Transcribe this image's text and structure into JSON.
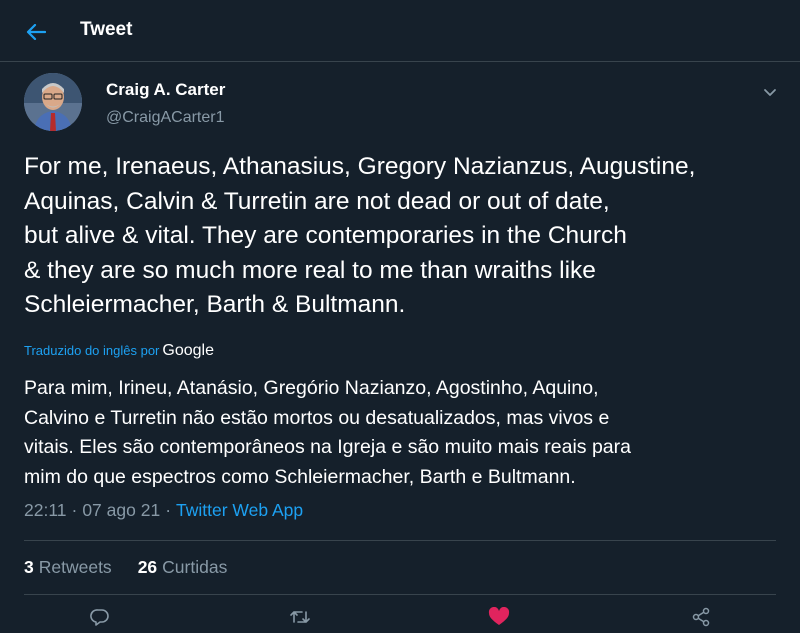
{
  "header": {
    "title": "Tweet",
    "back_icon": "arrow-left-icon",
    "accent": "#1da1f2"
  },
  "author": {
    "display_name": "Craig A. Carter",
    "handle": "@CraigACarter1"
  },
  "tweet": {
    "lines": [
      "For me, Irenaeus, Athanasius, Gregory Nazianzus, Augustine,",
      "Aquinas, Calvin & Turretin are not dead or out of date,",
      "but alive & vital. They are contemporaries in the Church",
      "& they are so much more real to me than wraiths like",
      "Schleiermacher, Barth & Bultmann."
    ]
  },
  "translation": {
    "label": "Traduzido do inglês por",
    "provider": "Google",
    "lines": [
      "Para mim, Irineu, Atanásio, Gregório Nazianzo, Agostinho, Aquino,",
      "Calvino e Turretin não estão mortos ou desatualizados, mas vivos e",
      "vitais. Eles são contemporâneos na Igreja e são muito mais reais para",
      "mim do que espectros como Schleiermacher, Barth e Bultmann."
    ]
  },
  "meta": {
    "time": "22:11",
    "date": "07 ago 21",
    "separator": "·",
    "app": "Twitter Web App"
  },
  "stats": {
    "retweets_count": "3",
    "retweets_label": "Retweets",
    "likes_count": "26",
    "likes_label": "Curtidas"
  },
  "actions": {
    "reply_icon": "reply-icon",
    "retweet_icon": "retweet-icon",
    "like_icon": "heart-icon",
    "like_color": "#e0245e",
    "share_icon": "share-icon"
  }
}
